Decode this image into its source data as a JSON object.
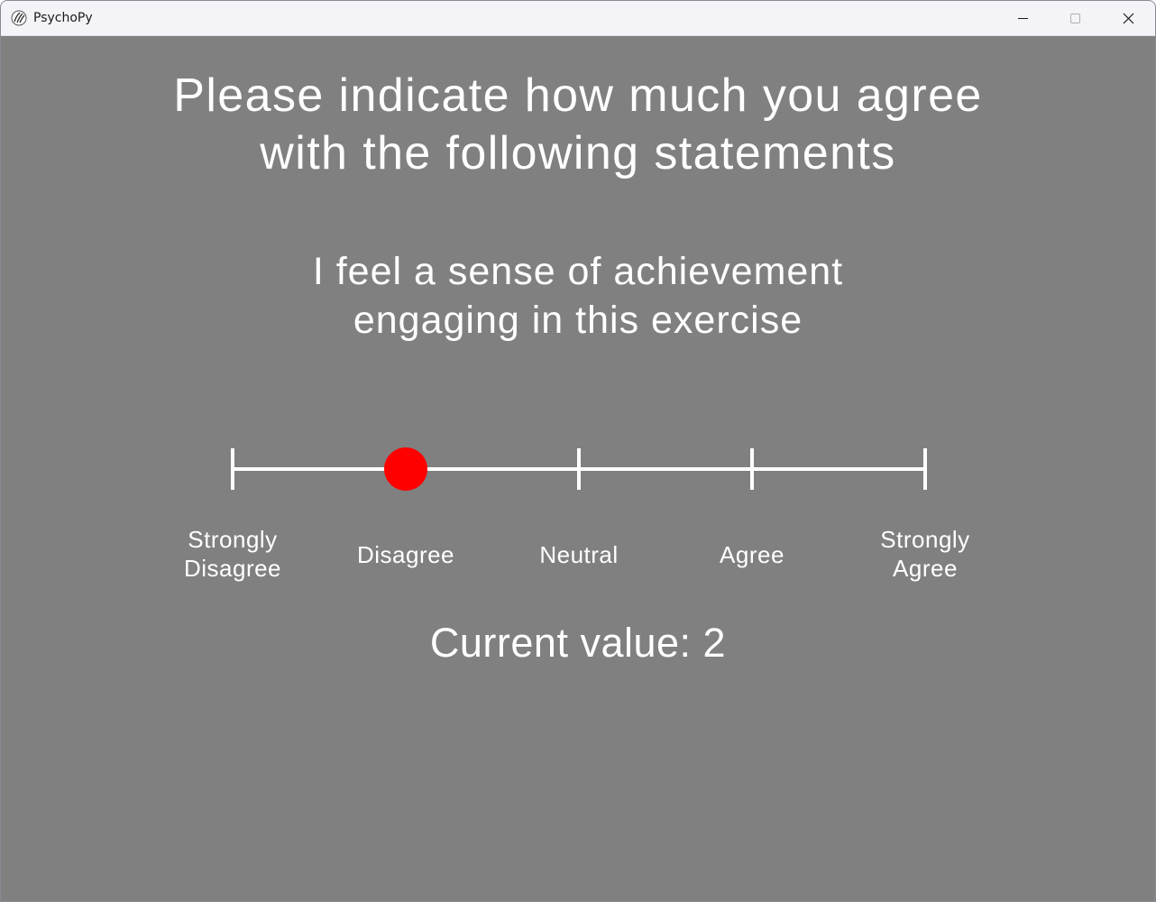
{
  "window": {
    "title": "PsychoPy",
    "app_icon": "psychopy-logo-icon",
    "controls": [
      "minimize-icon",
      "maximize-icon",
      "close-icon"
    ]
  },
  "colors": {
    "background": "#808080",
    "text": "#ffffff",
    "marker": "#ff0000",
    "scale_line": "#ffffff"
  },
  "instructions": {
    "line1": "Please indicate how much you agree",
    "line2": "with the following statements"
  },
  "statement": {
    "line1": "I feel a sense of achievement",
    "line2": "engaging in this exercise"
  },
  "scale": {
    "ticks": [
      {
        "value": 1,
        "label_line1": "Strongly",
        "label_line2": "Disagree"
      },
      {
        "value": 2,
        "label_line1": "Disagree",
        "label_line2": ""
      },
      {
        "value": 3,
        "label_line1": "Neutral",
        "label_line2": ""
      },
      {
        "value": 4,
        "label_line1": "Agree",
        "label_line2": ""
      },
      {
        "value": 5,
        "label_line1": "Strongly",
        "label_line2": "Agree"
      }
    ],
    "min": 1,
    "max": 5,
    "selected_value": 2
  },
  "current_value": {
    "text": "Current value: 2"
  }
}
